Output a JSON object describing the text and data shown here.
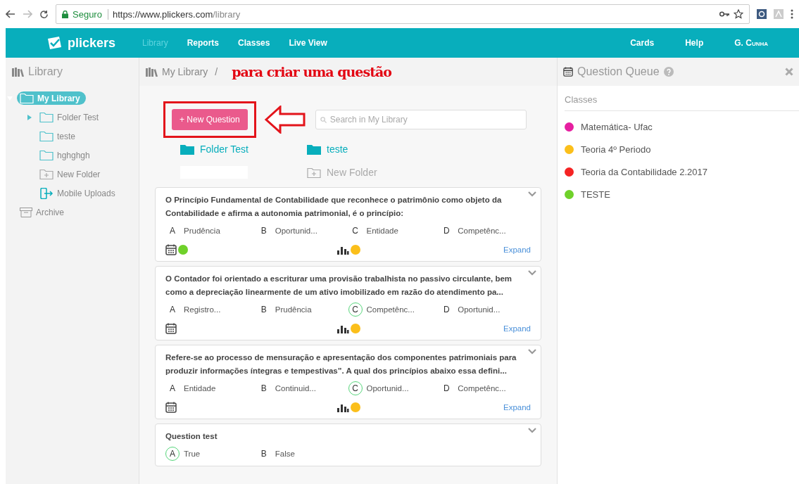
{
  "browser": {
    "security_label": "Seguro",
    "url_host": "https://www.plickers.com",
    "url_path": "/library"
  },
  "nav": {
    "logo": "plickers",
    "links": [
      {
        "label": "Library",
        "selected": true
      },
      {
        "label": "Reports",
        "selected": false
      },
      {
        "label": "Classes",
        "selected": false
      },
      {
        "label": "Live View",
        "selected": false
      }
    ],
    "right_links": [
      "Cards",
      "Help",
      "G. Cunha"
    ]
  },
  "sidebar": {
    "title": "Library",
    "tree": [
      {
        "label": "My Library",
        "kind": "folder",
        "selected": true,
        "expanded": true,
        "children": [
          {
            "label": "Folder Test",
            "kind": "folder",
            "selected": false,
            "expanded": false
          },
          {
            "label": "teste",
            "kind": "folder",
            "selected": false
          },
          {
            "label": "hghghgh",
            "kind": "folder",
            "selected": false
          },
          {
            "label": "New Folder",
            "kind": "new-folder",
            "selected": false
          },
          {
            "label": "Mobile Uploads",
            "kind": "mobile",
            "selected": false
          }
        ]
      },
      {
        "label": "Archive",
        "kind": "archive",
        "selected": false
      }
    ]
  },
  "main": {
    "breadcrumb": "My Library",
    "separator": "/",
    "annotation": "para criar uma questão",
    "new_button": "+ New Question",
    "search": {
      "placeholder": "Search in My Library"
    },
    "folders": [
      {
        "label": "Folder Test",
        "kind": "folder"
      },
      {
        "label": "teste",
        "kind": "folder"
      },
      {
        "kind": "blank"
      },
      {
        "label": "New Folder",
        "kind": "new"
      }
    ],
    "questions": [
      {
        "text": "O Princípio Fundamental de Contabilidade que reconhece o patrimônio como objeto da Contabilidade e afirma a autonomia patrimonial, é o princípio:",
        "answers": [
          {
            "letter": "A",
            "text": "Prudência",
            "correct": false
          },
          {
            "letter": "B",
            "text": "Oportunid...",
            "correct": false
          },
          {
            "letter": "C",
            "text": "Entidade",
            "correct": false
          },
          {
            "letter": "D",
            "text": "Competênc...",
            "correct": false
          }
        ],
        "queue_dot": {
          "color": "#6fd12a"
        },
        "report_dot": {
          "color": "#fbbf1b"
        },
        "expand": "Expand"
      },
      {
        "text": "O Contador foi orientado a escriturar uma provisão trabalhista no passivo circulante, bem como a depreciação linearmente de um ativo imobilizado em razão do atendimento pa...",
        "answers": [
          {
            "letter": "A",
            "text": "Registro...",
            "correct": false
          },
          {
            "letter": "B",
            "text": "Prudência",
            "correct": false
          },
          {
            "letter": "C",
            "text": "Competênc...",
            "correct": true
          },
          {
            "letter": "D",
            "text": "Oportunid...",
            "correct": false
          }
        ],
        "report_dot": {
          "color": "#fbbf1b"
        },
        "expand": "Expand"
      },
      {
        "text": "Refere-se ao processo de mensuração e apresentação dos componentes patrimoniais para produzir informações íntegras e tempestivas”. A qual dos princípios abaixo essa defini...",
        "answers": [
          {
            "letter": "A",
            "text": "Entidade",
            "correct": false
          },
          {
            "letter": "B",
            "text": "Continuid...",
            "correct": false
          },
          {
            "letter": "C",
            "text": "Oportunid...",
            "correct": true
          },
          {
            "letter": "D",
            "text": "Competênc...",
            "correct": false
          }
        ],
        "report_dot": {
          "color": "#fbbf1b"
        },
        "expand": "Expand"
      },
      {
        "text": "Question test",
        "answers": [
          {
            "letter": "A",
            "text": "True",
            "correct": true
          },
          {
            "letter": "B",
            "text": "False",
            "correct": false
          }
        ]
      }
    ]
  },
  "queue": {
    "title": "Question Queue",
    "section": "Classes",
    "classes": [
      {
        "name": "Matemática- Ufac",
        "color": "#e61fa0"
      },
      {
        "name": "Teoria 4º Periodo",
        "color": "#fbbf1b"
      },
      {
        "name": "Teoria da Contabilidade 2.2017",
        "color": "#f52323"
      },
      {
        "name": "TESTE",
        "color": "#6fd12a"
      }
    ]
  }
}
